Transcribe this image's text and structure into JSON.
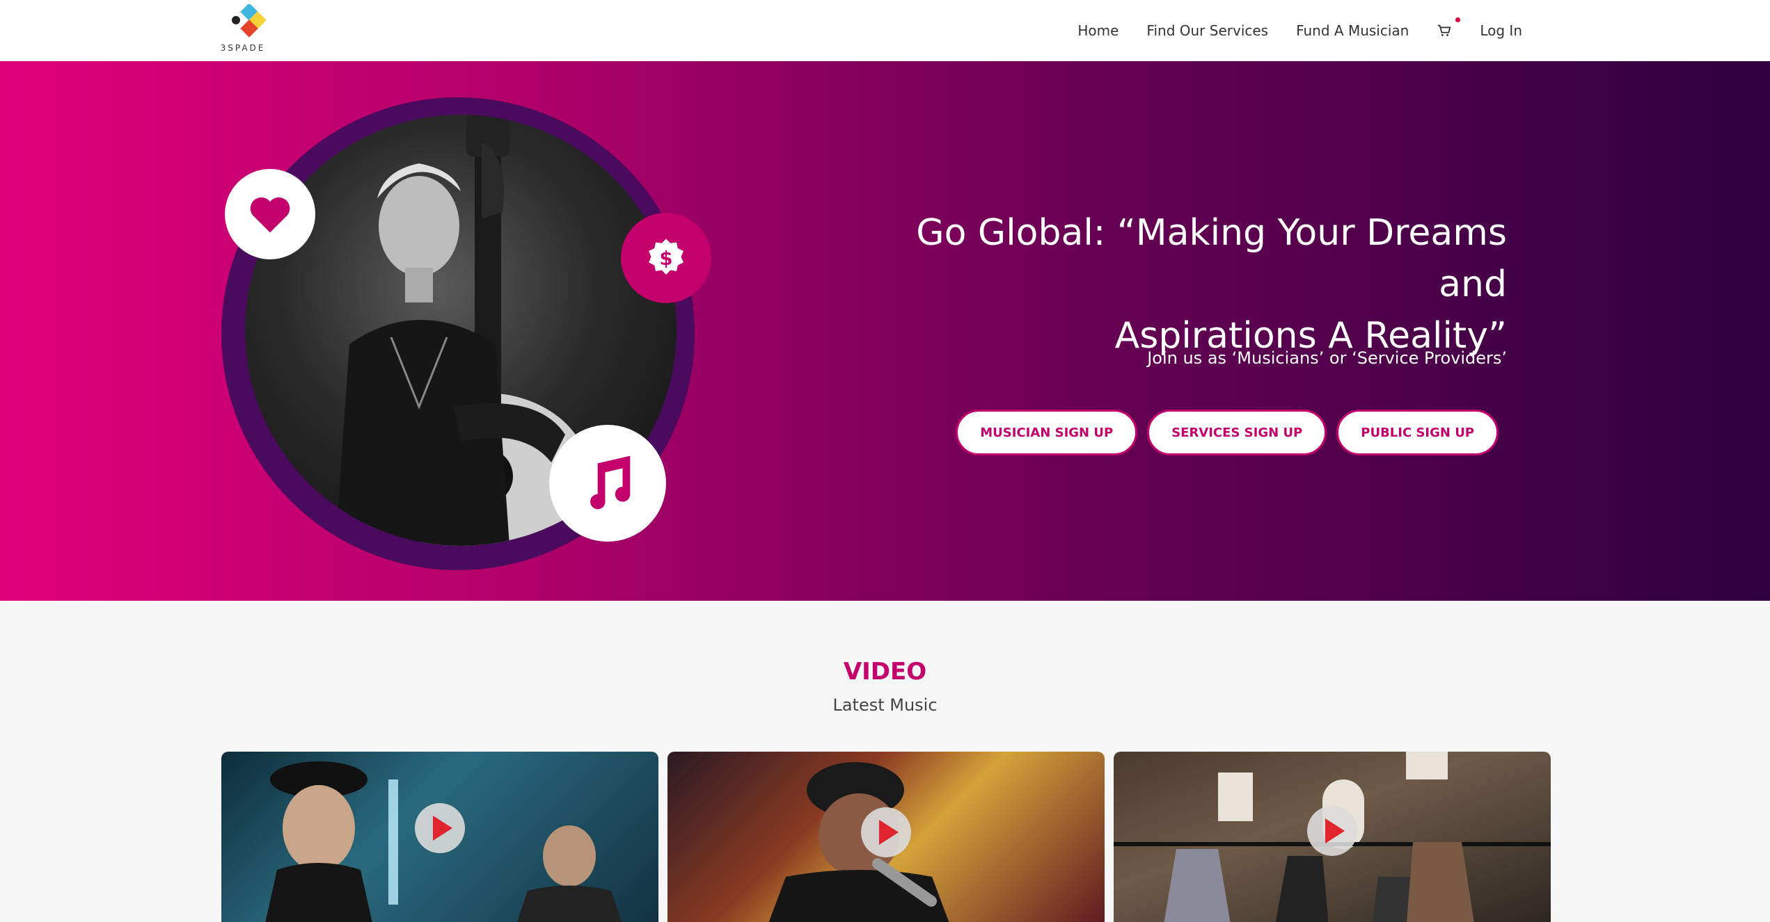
{
  "brand": {
    "name": "3SPADE"
  },
  "nav": {
    "home": "Home",
    "services": "Find Our Services",
    "fund": "Fund A Musician",
    "login": "Log In"
  },
  "hero": {
    "title_line1": "Go Global: “Making Your Dreams and",
    "title_line2": "Aspirations A Reality”",
    "subtitle": "Join us as ‘Musicians’ or ‘Service Providers’",
    "buttons": {
      "musician": "MUSICIAN SIGN UP",
      "services": "SERVICES SIGN UP",
      "public": "PUBLIC SIGN UP"
    }
  },
  "video": {
    "title": "VIDEO",
    "subtitle": "Latest Music"
  },
  "colors": {
    "accent": "#c3006c",
    "gradient_start": "#e0007a",
    "gradient_end": "#2e0040"
  }
}
